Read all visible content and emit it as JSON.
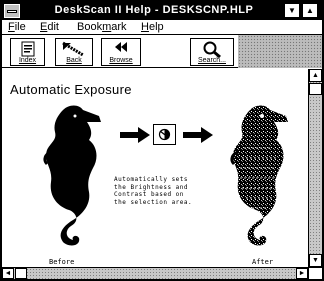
{
  "window": {
    "title": "DeskScan II Help - DESKSCNP.HLP",
    "minimize_glyph": "▼",
    "maximize_glyph": "▲"
  },
  "menu": {
    "file": {
      "accel": "F",
      "rest": "ile"
    },
    "edit": {
      "accel": "E",
      "rest": "dit"
    },
    "bookmark": {
      "pre": "Book",
      "accel": "m",
      "rest": "ark"
    },
    "help": {
      "accel": "H",
      "rest": "elp"
    }
  },
  "toolbar": {
    "index": "Index",
    "back": "Back",
    "browse": "Browse",
    "search": "Search..."
  },
  "content": {
    "title": "Automatic Exposure",
    "description": "Automatically sets the Brightness and Contrast based on the selection area.",
    "before_label": "Before",
    "after_label": "After"
  },
  "scrollbars": {
    "up": "▲",
    "down": "▼",
    "left": "◄",
    "right": "►"
  }
}
